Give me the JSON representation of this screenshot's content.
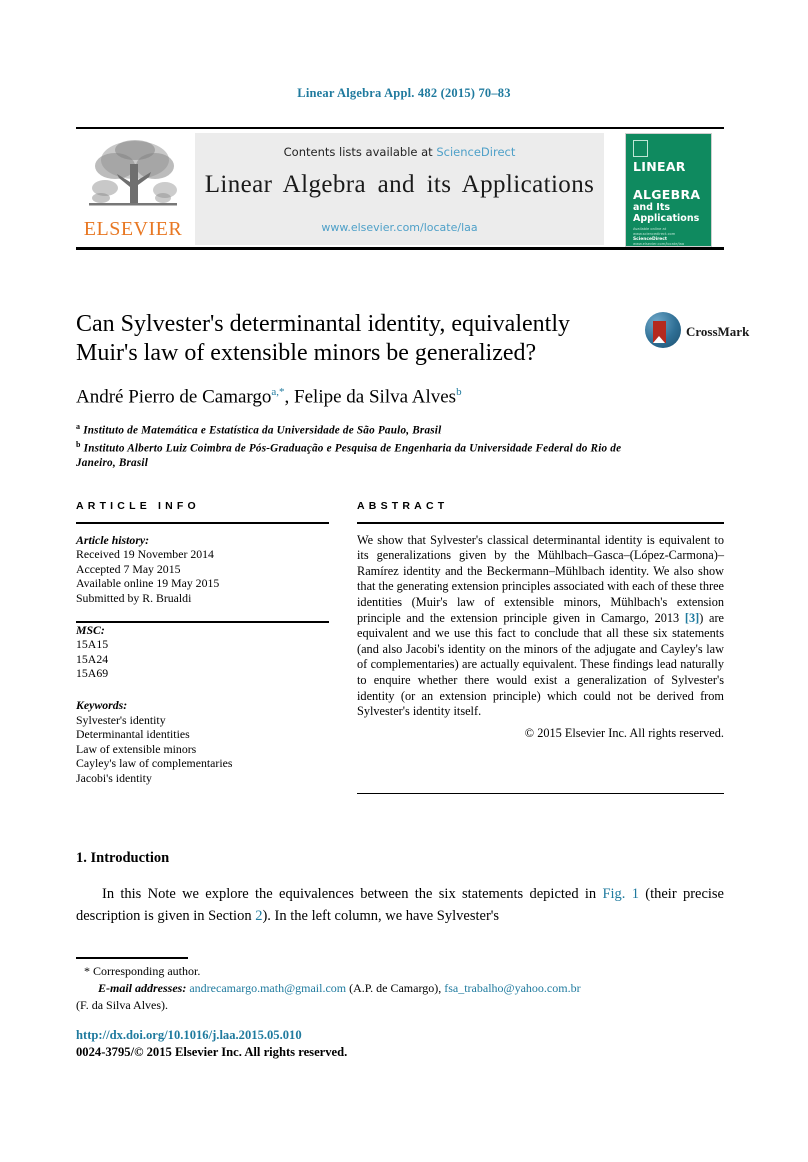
{
  "running_head": "Linear Algebra Appl. 482 (2015) 70–83",
  "masthead": {
    "contents_prefix": "Contents lists available at",
    "sciencedirect": "ScienceDirect",
    "journal_name": "Linear Algebra and its Applications",
    "journal_url": "www.elsevier.com/locate/laa",
    "publisher_name": "ELSEVIER",
    "cover": {
      "line1": "LINEAR",
      "line2": "ALGEBRA",
      "line3": "and Its Applications",
      "footer_small": "Available online at www.sciencedirect.com",
      "footer_brand": "ScienceDirect",
      "footer_tail": "www.elsevier.com/locate/laa"
    },
    "colors": {
      "link": "#4ea0c8",
      "cover_green": "#0f8a5f",
      "elsevier_orange": "#e87722",
      "panel_grey": "#ececec"
    }
  },
  "crossmark": {
    "label": "CrossMark"
  },
  "article": {
    "title_line1": "Can Sylvester's determinantal identity, equivalently",
    "title_line2": "Muir's law of extensible minors be generalized?",
    "author1": "André Pierro de Camargo",
    "author1_marks": "a,*",
    "author_sep": ", ",
    "author2": "Felipe da Silva Alves",
    "author2_marks": "b",
    "affiliation_a_mark": "a",
    "affiliation_a": "Instituto de Matemática e Estatística da Universidade de São Paulo, Brasil",
    "affiliation_b_mark": "b",
    "affiliation_b": "Instituto Alberto Luiz Coimbra de Pós-Graduação e Pesquisa de Engenharia da Universidade Federal do Rio de Janeiro, Brasil"
  },
  "info": {
    "heading": "ARTICLE INFO",
    "history_label": "Article history:",
    "history": [
      "Received 19 November 2014",
      "Accepted 7 May 2015",
      "Available online 19 May 2015",
      "Submitted by R. Brualdi"
    ],
    "msc_label": "MSC:",
    "msc": [
      "15A15",
      "15A24",
      "15A69"
    ],
    "keywords_label": "Keywords:",
    "keywords": [
      "Sylvester's identity",
      "Determinantal identities",
      "Law of extensible minors",
      "Cayley's law of complementaries",
      "Jacobi's identity"
    ]
  },
  "abstract": {
    "heading": "ABSTRACT",
    "part1": "We show that Sylvester's classical determinantal identity is equivalent to its generalizations given by the Mühlbach–Gasca–(López-Carmona)–Ramírez identity and the Beckermann–Mühlbach identity. We also show that the generating extension principles associated with each of these three identities (Muir's law of extensible minors, Mühlbach's extension principle and the extension principle given in Camargo, 2013 ",
    "ref_link": "[3]",
    "part2": ") are equivalent and we use this fact to conclude that all these six statements (and also Jacobi's identity on the minors of the adjugate and Cayley's law of complementaries) are actually equivalent. These findings lead naturally to enquire whether there would exist a generalization of Sylvester's identity (or an extension principle) which could not be derived from Sylvester's identity itself.",
    "copyright": "© 2015 Elsevier Inc. All rights reserved."
  },
  "body": {
    "section_heading": "1. Introduction",
    "para_part1": "In this Note we explore the equivalences between the six statements depicted in ",
    "fig_link": "Fig. 1",
    "para_part2": " (their precise description is given in Section ",
    "section_link": "2",
    "para_part3": "). In the left column, we have Sylvester's"
  },
  "footnotes": {
    "corresponding": "* Corresponding author.",
    "email_label": "E-mail addresses:",
    "email1": "andrecamargo.math@gmail.com",
    "email1_owner": " (A.P. de Camargo), ",
    "email2": "fsa_trabalho@yahoo.com.br",
    "email2_owner": "(F. da Silva Alves).",
    "doi": "http://dx.doi.org/10.1016/j.laa.2015.05.010",
    "issn": "0024-3795/© 2015 Elsevier Inc. All rights reserved."
  }
}
